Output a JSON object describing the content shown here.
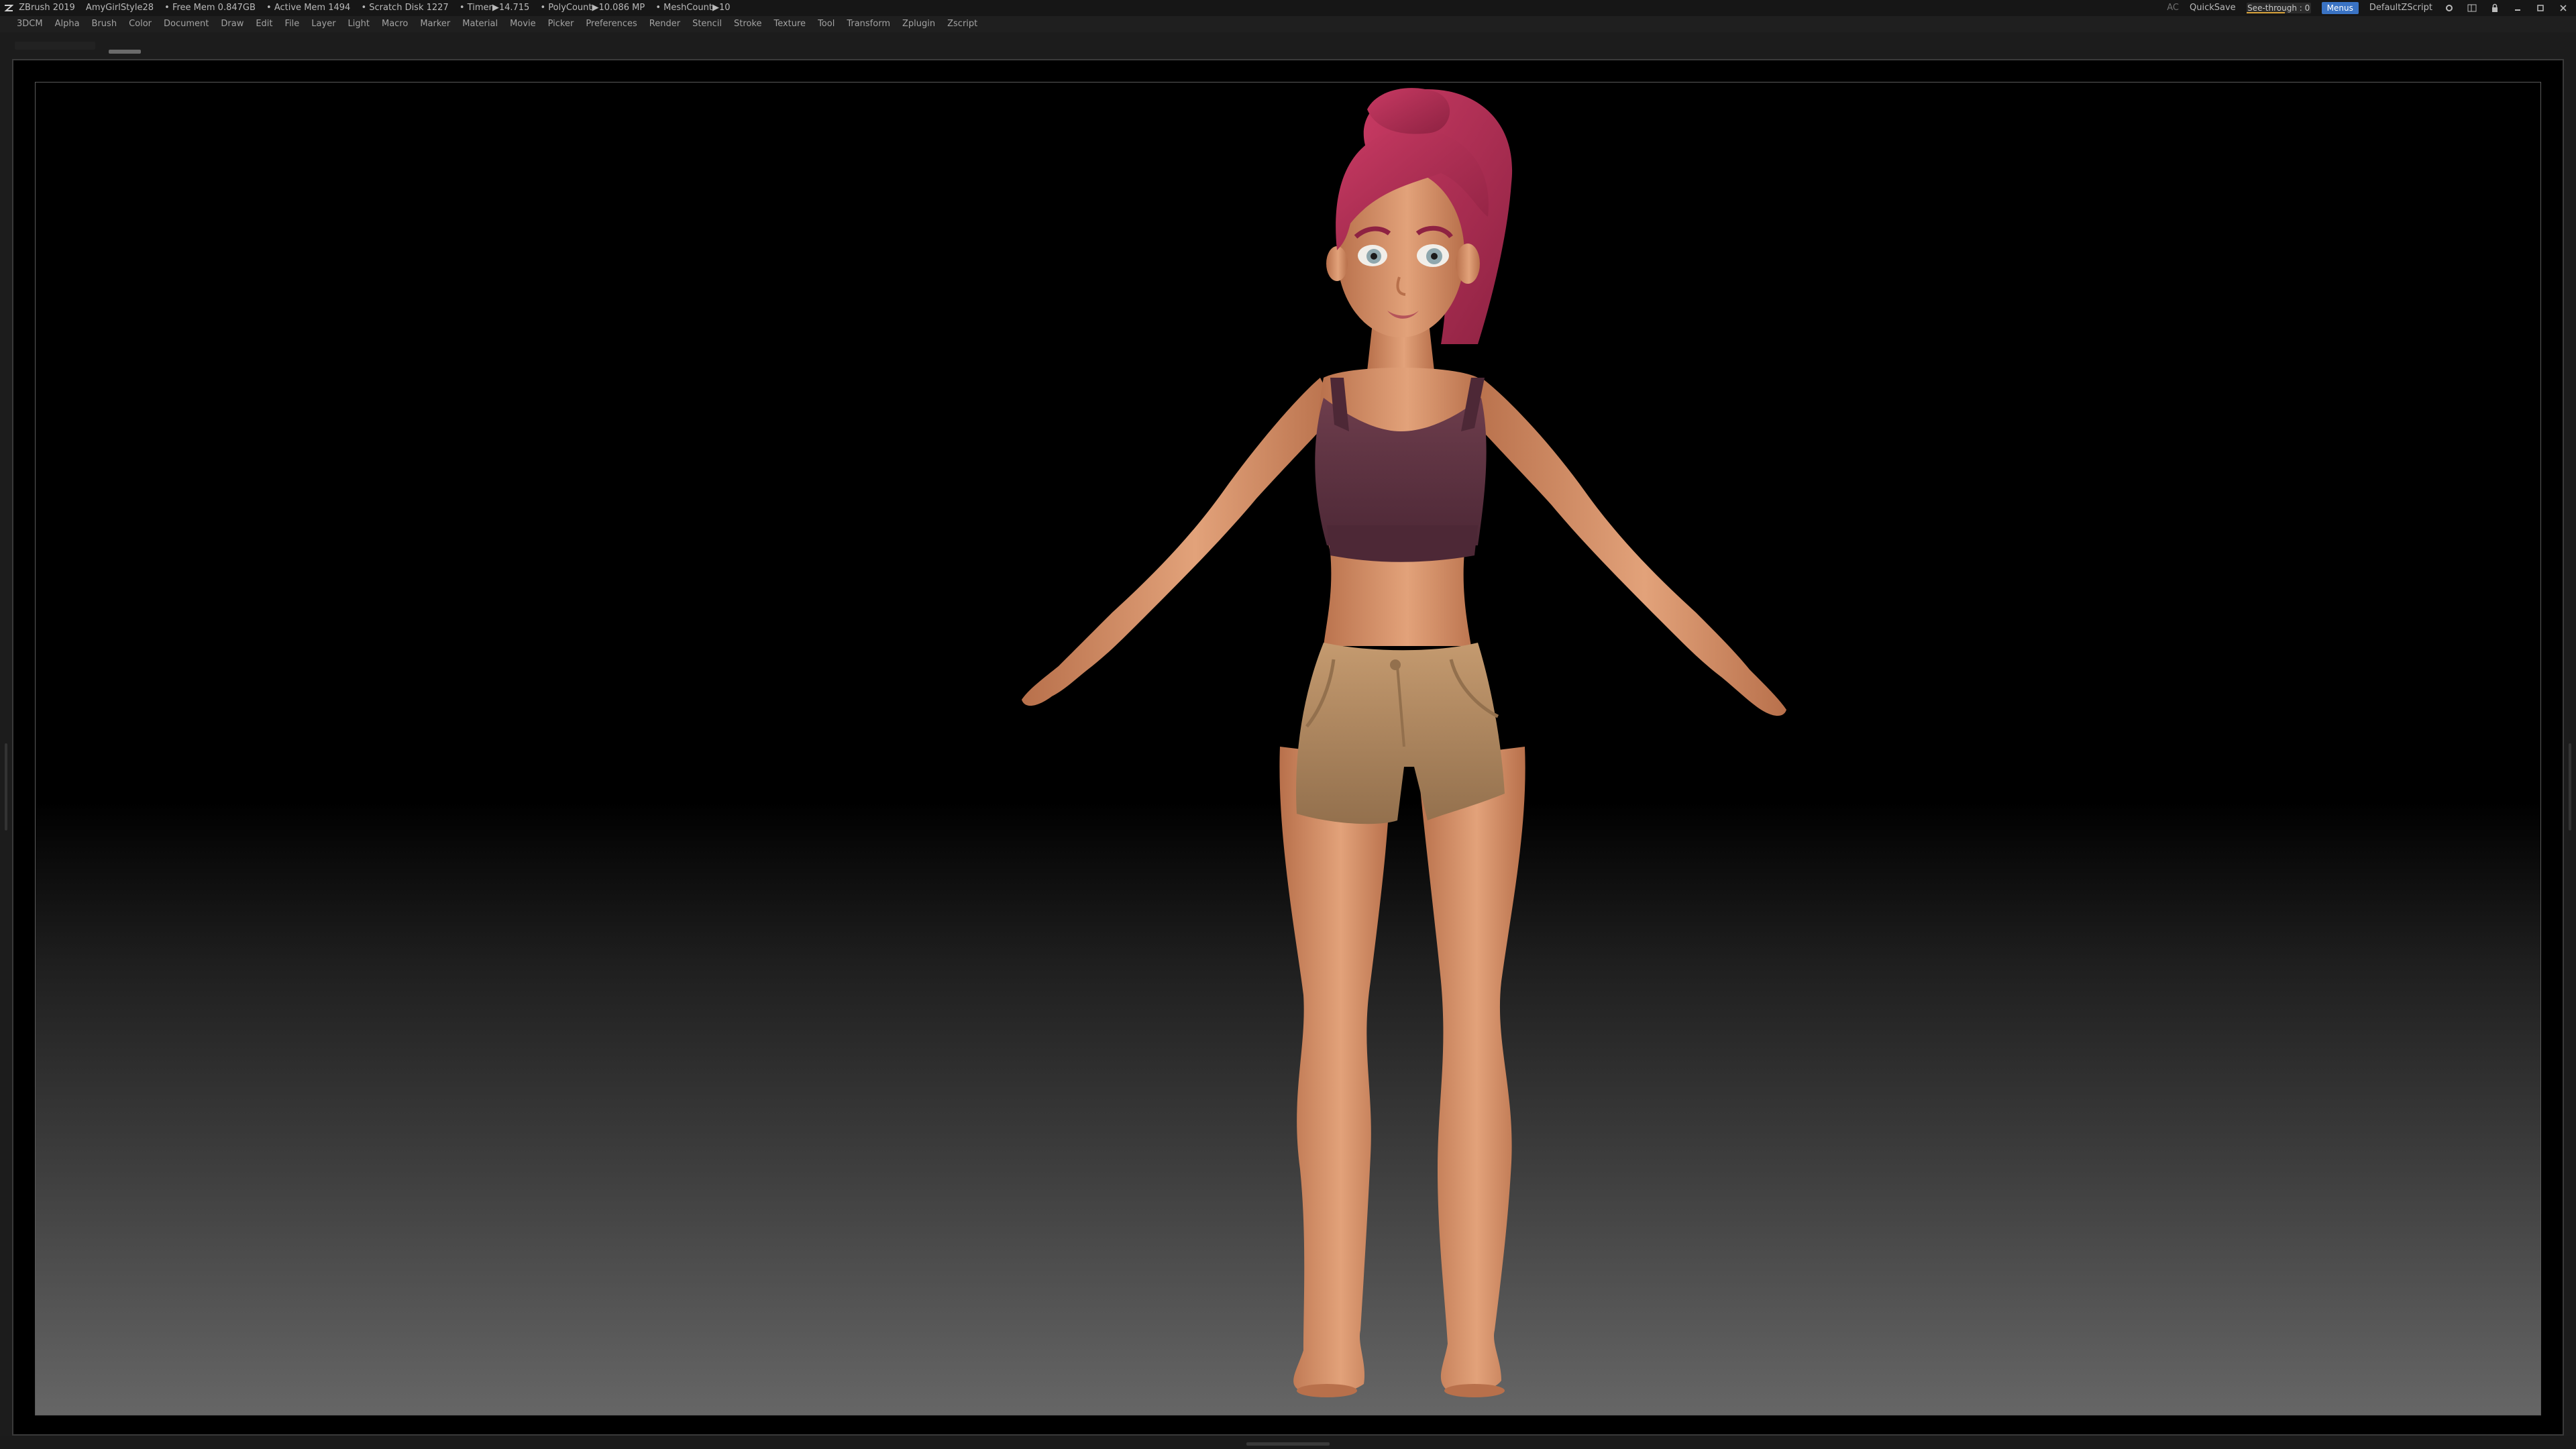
{
  "titlebar": {
    "app": "ZBrush 2019",
    "document": "AmyGirlStyle28",
    "free_mem": "• Free Mem 0.847GB",
    "active_mem": "• Active Mem 1494",
    "scratch_disk": "• Scratch Disk 1227",
    "timer": "• Timer▶14.715",
    "polycount": "• PolyCount▶10.086 MP",
    "meshcount": "• MeshCount▶10",
    "ac": "AC",
    "quicksave": "QuickSave",
    "see_through_label": "See-through",
    "see_through_value": "0",
    "menus_label": "Menus",
    "script": "DefaultZScript"
  },
  "menubar": {
    "items": [
      "3DCM",
      "Alpha",
      "Brush",
      "Color",
      "Document",
      "Draw",
      "Edit",
      "File",
      "Layer",
      "Light",
      "Macro",
      "Marker",
      "Material",
      "Movie",
      "Picker",
      "Preferences",
      "Render",
      "Stencil",
      "Stroke",
      "Texture",
      "Tool",
      "Transform",
      "Zplugin",
      "Zscript"
    ]
  },
  "viewport": {
    "subject": "stylized female character, A-pose",
    "colors": {
      "skin": "#e2a27a",
      "skin_shadow": "#b8704b",
      "hair": "#c83a63",
      "hair_shadow": "#8e2242",
      "top": "#6d3d4c",
      "top_shadow": "#4d2836",
      "shorts": "#c49a6f",
      "shorts_shadow": "#93704d",
      "eye": "#8fa7ad"
    }
  },
  "icons": {
    "logo": "zbrush-logo-icon",
    "window": [
      "settings-icon",
      "layout-icon",
      "minimize-icon",
      "restore-icon",
      "close-icon"
    ]
  }
}
